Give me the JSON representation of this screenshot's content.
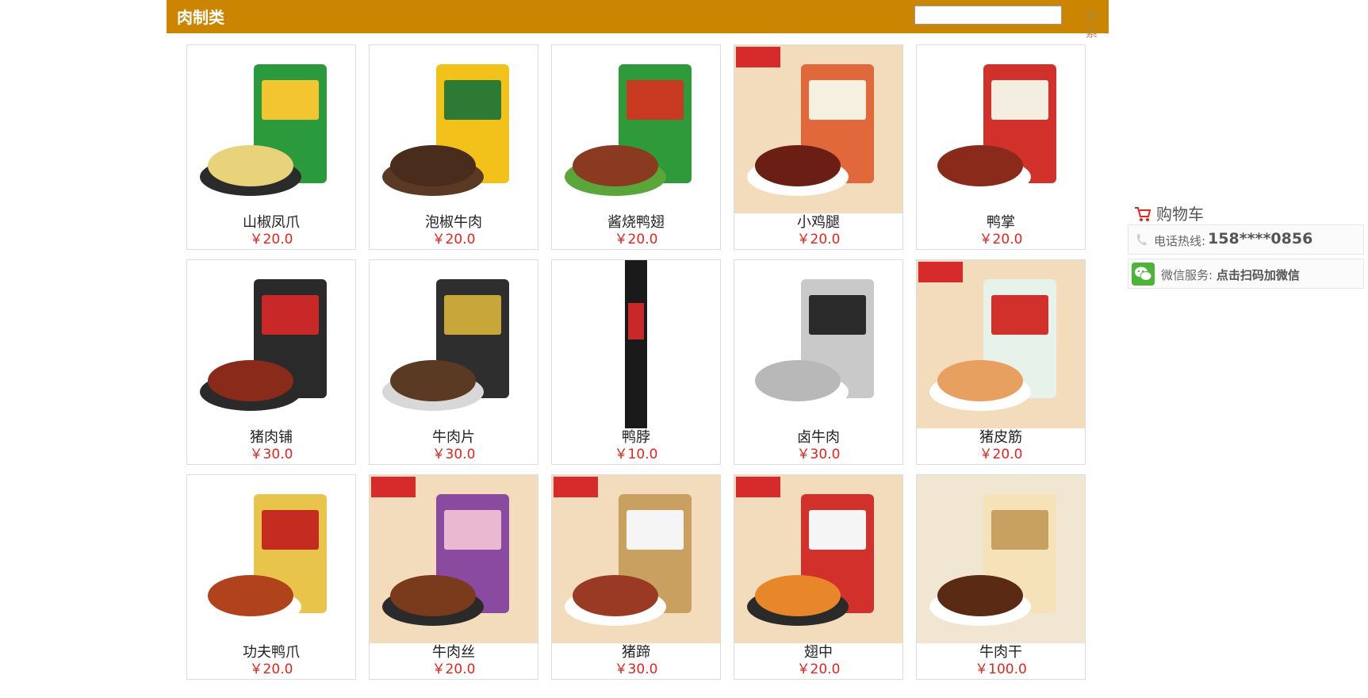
{
  "header": {
    "title": "肉制类",
    "search_placeholder": "",
    "search_button": "搜索"
  },
  "products": [
    {
      "name": "山椒凤爪",
      "price": "￥20.0"
    },
    {
      "name": "泡椒牛肉",
      "price": "￥20.0"
    },
    {
      "name": "酱烧鸭翅",
      "price": "￥20.0"
    },
    {
      "name": "小鸡腿",
      "price": "￥20.0"
    },
    {
      "name": "鸭掌",
      "price": "￥20.0"
    },
    {
      "name": "猪肉铺",
      "price": "￥30.0"
    },
    {
      "name": "牛肉片",
      "price": "￥30.0"
    },
    {
      "name": "鸭脖",
      "price": "￥10.0"
    },
    {
      "name": "卤牛肉",
      "price": "￥30.0"
    },
    {
      "name": "猪皮筋",
      "price": "￥20.0"
    },
    {
      "name": "功夫鸭爪",
      "price": "￥20.0"
    },
    {
      "name": "牛肉丝",
      "price": "￥20.0"
    },
    {
      "name": "猪蹄",
      "price": "￥30.0"
    },
    {
      "name": "翅中",
      "price": "￥20.0"
    },
    {
      "name": "牛肉干",
      "price": "￥100.0"
    }
  ],
  "sidebar": {
    "cart_label": "购物车",
    "hotline_label": "电话热线:",
    "hotline_number": "158****0856",
    "wechat_label": "微信服务:",
    "wechat_action": "点击扫码加微信"
  },
  "colors": {
    "header_bg": "#cc8500",
    "price": "#e8231b",
    "cart_icon": "#e8231b",
    "wechat": "#4cb538"
  }
}
